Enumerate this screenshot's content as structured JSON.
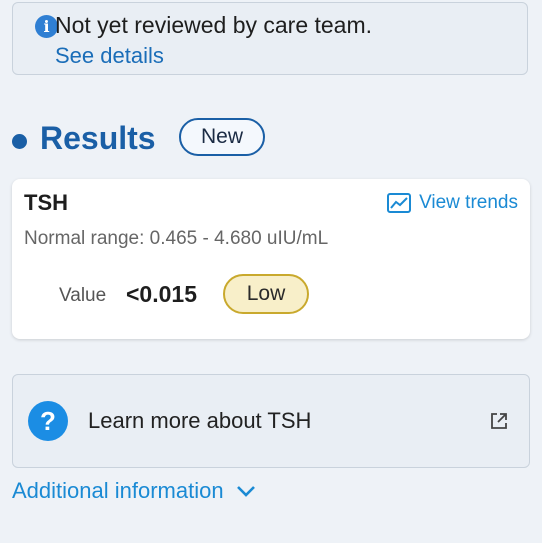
{
  "notice": {
    "icon": "info-icon",
    "message": "Not yet reviewed by care team.",
    "link": "See details"
  },
  "results": {
    "heading": "Results",
    "badge": "New"
  },
  "test": {
    "name": "TSH",
    "trends_label": "View trends",
    "trends_icon": "trend-chart-icon",
    "range": "Normal range: 0.465 - 4.680 uIU/mL",
    "value_label": "Value",
    "value": "<0.015",
    "flag": "Low"
  },
  "learn": {
    "icon": "question-icon",
    "label": "Learn more about TSH",
    "external_icon": "external-link-icon"
  },
  "additional": {
    "label": "Additional information",
    "icon": "chevron-down-icon"
  },
  "colors": {
    "accent": "#1a5fa6",
    "link": "#1a8ad4",
    "low_badge": "#f8efc9"
  }
}
